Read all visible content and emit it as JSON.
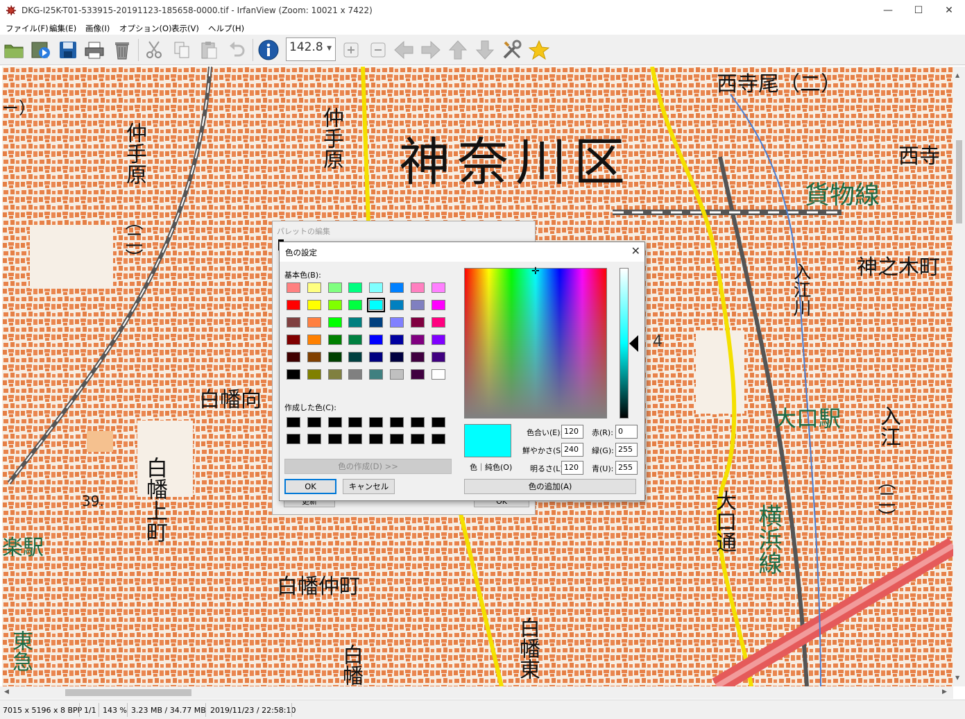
{
  "window": {
    "title": "DKG-I25K-T01-533915-20191123-185658-0000.tif - IrfanView (Zoom: 10021 x 7422)",
    "minimize": "—",
    "maximize": "☐",
    "close": "✕"
  },
  "menu": [
    "ファイル(F)",
    "編集(E)",
    "画像(I)",
    "オプション(O)",
    "表示(V)",
    "ヘルプ(H)"
  ],
  "toolbar": {
    "zoom_value": "142.8",
    "icons": [
      "open-folder-icon",
      "slideshow-icon",
      "save-icon",
      "print-icon",
      "delete-icon",
      "cut-icon",
      "copy-icon",
      "paste-icon",
      "undo-icon",
      "info-icon",
      "zoom-in-icon",
      "zoom-out-icon",
      "prev-arrow-icon",
      "next-arrow-icon",
      "up-arrow-icon",
      "down-arrow-icon",
      "settings-tools-icon",
      "favorite-star-icon"
    ]
  },
  "map": {
    "labels": {
      "ward": "神奈川区",
      "nishiteraoo2": "西寺尾（二）",
      "nishitera": "西寺",
      "kamotsusen": "貨物線",
      "kaminokicho": "神之木町",
      "nakatebara_l": "仲手原",
      "nakatebara_l_num": "（二）",
      "nakatebara_c": "仲手原",
      "hakuhamukai": "白幡向",
      "hakuhakamicho": "白幡上町",
      "hakuhanakacho": "白幡仲町",
      "hakuhahigashi": "白幡東",
      "hakuha_b": "白幡",
      "oguchi_station": "大口駅",
      "oguchidori": "大口通",
      "yokohamasen": "横浜線",
      "irie": "入江",
      "irie_num": "（二）",
      "iriekawa": "入江川",
      "rakuen_station": "楽駅",
      "toyoko": "東急",
      "elevation": "39.",
      "corner": "ー）",
      "number4": "4"
    }
  },
  "palette_dialog": {
    "title": "パレットの編集",
    "ok_partial": "OK",
    "left_partial": "更新"
  },
  "color_dialog": {
    "title": "色の設定",
    "close": "✕",
    "basic_colors_label": "基本色(B):",
    "custom_colors_label": "作成した色(C):",
    "define_custom_button": "色の作成(D) >>",
    "ok_button": "OK",
    "cancel_button": "キャンセル",
    "add_color_button": "色の追加(A)",
    "color_solid_label": "色｜純色(O)",
    "hue_label": "色合い(E):",
    "sat_label": "鮮やかさ(S):",
    "lum_label": "明るさ(L):",
    "red_label": "赤(R):",
    "green_label": "緑(G):",
    "blue_label": "青(U):",
    "hue": "120",
    "sat": "240",
    "lum": "120",
    "red": "0",
    "green": "255",
    "blue": "255",
    "current_color": "#00ffff",
    "basic_colors": [
      [
        "#ff8080",
        "#ffff80",
        "#80ff80",
        "#00ff80",
        "#80ffff",
        "#0080ff",
        "#ff80c0",
        "#ff80ff"
      ],
      [
        "#ff0000",
        "#ffff00",
        "#80ff00",
        "#00ff40",
        "#00ffff",
        "#0080c0",
        "#8080c0",
        "#ff00ff"
      ],
      [
        "#804040",
        "#ff8040",
        "#00ff00",
        "#008080",
        "#004080",
        "#8080ff",
        "#800040",
        "#ff0080"
      ],
      [
        "#800000",
        "#ff8000",
        "#008000",
        "#008040",
        "#0000ff",
        "#0000a0",
        "#800080",
        "#8000ff"
      ],
      [
        "#400000",
        "#804000",
        "#004000",
        "#004040",
        "#000080",
        "#000040",
        "#400040",
        "#400080"
      ],
      [
        "#000000",
        "#808000",
        "#808040",
        "#808080",
        "#408080",
        "#c0c0c0",
        "#400040",
        "#ffffff"
      ]
    ],
    "selected_swatch": "row1-col4"
  },
  "status": {
    "dimensions": "7015 x 5196 x 8 BPP",
    "page": "1/1",
    "zoom": "143 %",
    "size": "3.23 MB / 34.77 MB",
    "date": "2019/11/23 / 22:58:10"
  }
}
